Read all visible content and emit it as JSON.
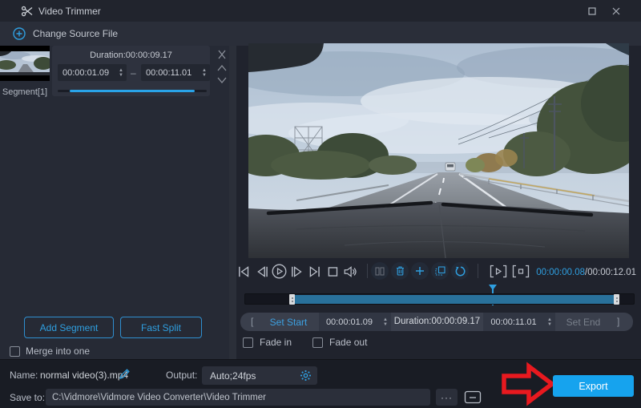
{
  "window": {
    "title": "Video Trimmer"
  },
  "toolbar": {
    "change_source_label": "Change Source File"
  },
  "segment_panel": {
    "segment_label": "Segment[1]",
    "card": {
      "duration": "Duration:00:00:09.17",
      "start": "00:00:01.09",
      "separator": "–",
      "end": "00:00:11.01"
    },
    "add_segment_label": "Add Segment",
    "fast_split_label": "Fast Split",
    "merge_label": "Merge into one"
  },
  "player": {
    "time_current": "00:00:00.08",
    "time_total": "/00:00:12.01"
  },
  "trim": {
    "bracket_open": "[",
    "bracket_close": "]",
    "set_start_label": "Set Start",
    "start_value": "00:00:01.09",
    "duration_label": "Duration:00:00:09.17",
    "end_value": "00:00:11.01",
    "set_end_label": "Set End",
    "fade_in_label": "Fade in",
    "fade_out_label": "Fade out"
  },
  "footer": {
    "name_label": "Name:",
    "name_value": "normal video(3).mp4",
    "output_label": "Output:",
    "output_value": "Auto;24fps",
    "save_to_label": "Save to:",
    "save_to_value": "C:\\Vidmore\\Vidmore Video Converter\\Video Trimmer",
    "more_label": "···",
    "export_label": "Export"
  },
  "icons": {
    "spinner_up": "▲",
    "spinner_down": "▼"
  },
  "colors": {
    "accent": "#2f9fe0",
    "export_button": "#16a3ee",
    "timeline_selection": "#29719b",
    "annotation_arrow": "#e8191f"
  }
}
